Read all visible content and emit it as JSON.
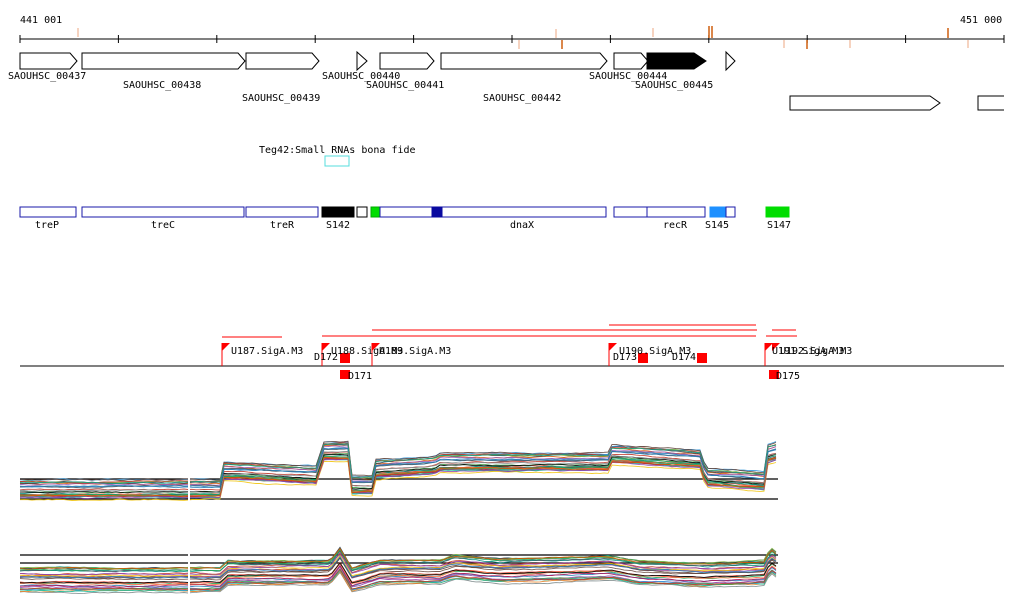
{
  "ruler": {
    "start_label": "441 001",
    "end_label": "451 000"
  },
  "genes": [
    {
      "label": "SAOUHSC_00437"
    },
    {
      "label": "SAOUHSC_00438"
    },
    {
      "label": "SAOUHSC_00439"
    },
    {
      "label": "SAOUHSC_00440"
    },
    {
      "label": "SAOUHSC_00441"
    },
    {
      "label": "SAOUHSC_00442"
    },
    {
      "label": "SAOUHSC_00444"
    },
    {
      "label": "SAOUHSC_00445"
    }
  ],
  "srna": {
    "label": "Teg42:Small RNAs bona fide"
  },
  "operons": [
    {
      "label": "treP"
    },
    {
      "label": "treC"
    },
    {
      "label": "treR"
    },
    {
      "label": "S142"
    },
    {
      "label": "dnaX"
    },
    {
      "label": "recR"
    },
    {
      "label": "S145"
    },
    {
      "label": "S147"
    }
  ],
  "promoters": [
    {
      "label": "U187.SigA.M3"
    },
    {
      "label": "U188.SigA.M3"
    },
    {
      "label": "U189.SigA.M3"
    },
    {
      "label": "U190.SigA.M3"
    },
    {
      "label": "U191.SigA.M3"
    },
    {
      "label": "U192.SigA.M3"
    }
  ],
  "terminators": [
    {
      "label": "D171"
    },
    {
      "label": "D172"
    },
    {
      "label": "D173"
    },
    {
      "label": "D174"
    },
    {
      "label": "D175"
    }
  ],
  "colors": {
    "gene_highlight": "#000000",
    "srna_box": "#55dddd",
    "operon_outline": "#1a1aa8",
    "promoter": "#ff0000",
    "s145": "#1e90ff",
    "s147": "#00dd00",
    "dnax_mark": "#0a0aa0",
    "tss_marks": "#d2691e"
  }
}
